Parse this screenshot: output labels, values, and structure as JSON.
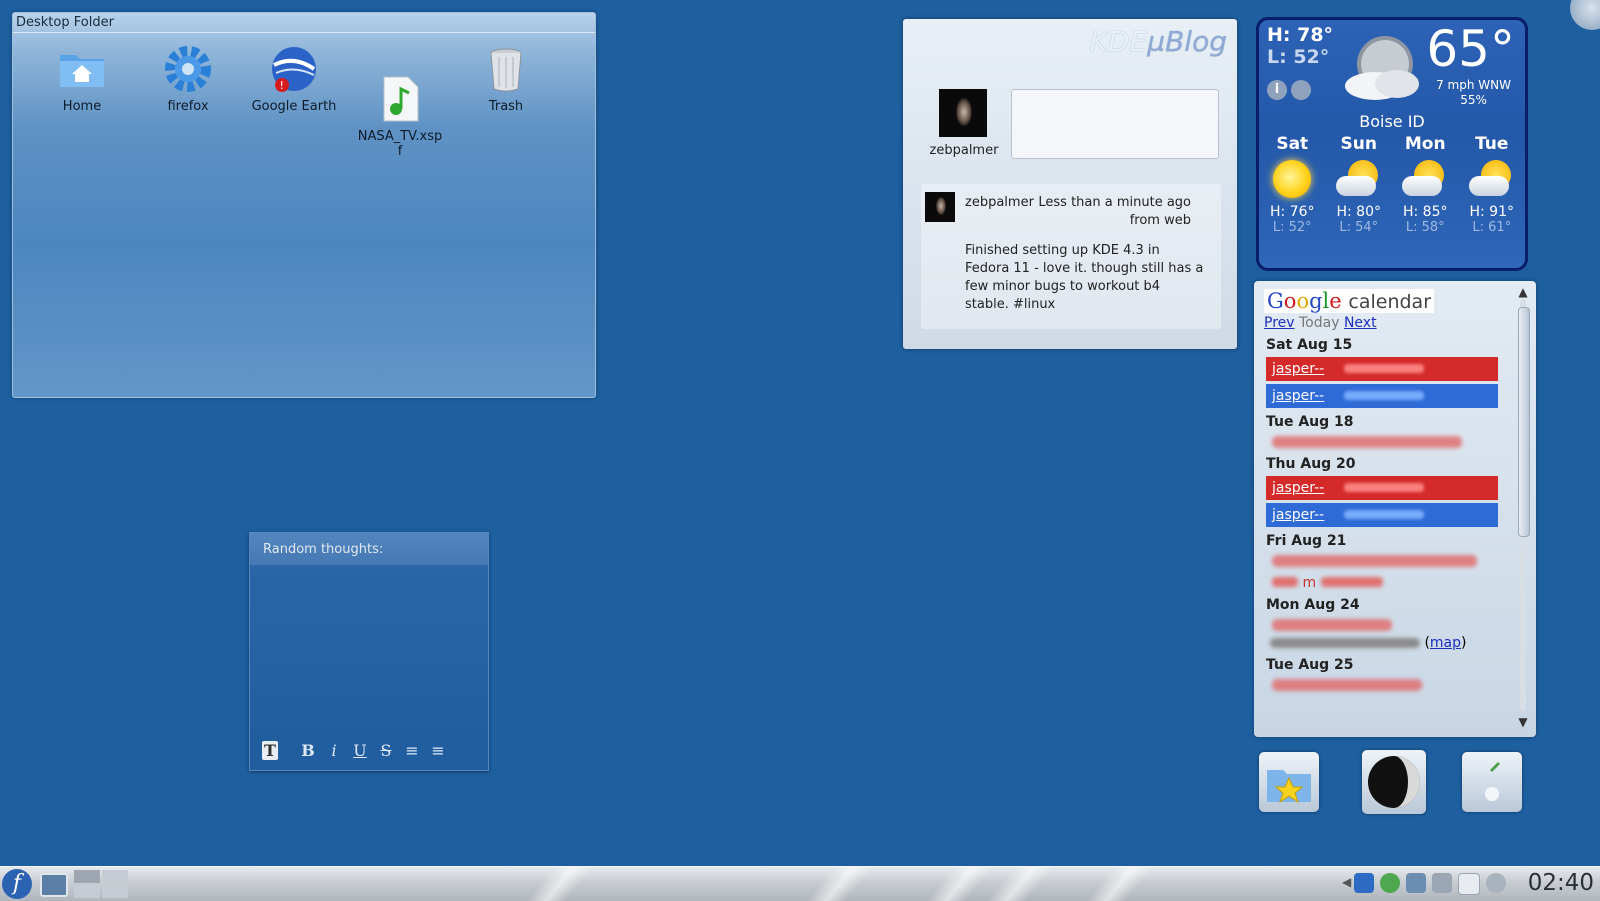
{
  "desktop_folder": {
    "title": "Desktop Folder",
    "items": [
      {
        "label": "Home",
        "icon": "home-folder-icon"
      },
      {
        "label": "firefox",
        "icon": "gear-icon"
      },
      {
        "label": "Google Earth",
        "icon": "globe-icon"
      },
      {
        "label": "NASA_TV.xsp\nf",
        "icon": "audio-file-icon"
      },
      {
        "label": "Trash",
        "icon": "trash-icon"
      }
    ]
  },
  "microblog": {
    "logo_prefix": "KDE",
    "logo_suffix": "µBlog",
    "username": "zebpalmer",
    "post": {
      "user": "zebpalmer",
      "time": "Less than a minute ago",
      "source": "from web",
      "text": "Finished setting up KDE 4.3 in Fedora 11 - love it. though still has a few minor bugs to workout b4 stable. #linux"
    }
  },
  "weather": {
    "high": "H: 78°",
    "low": "L: 52°",
    "current_temp": "65°",
    "wind": "7 mph WNW",
    "humidity": "55%",
    "city": "Boise ID",
    "forecast": [
      {
        "day": "Sat",
        "high": "H: 76°",
        "low": "L: 52°",
        "icon": "sun-icon"
      },
      {
        "day": "Sun",
        "high": "H: 80°",
        "low": "L: 54°",
        "icon": "partly-cloudy-icon"
      },
      {
        "day": "Mon",
        "high": "H: 85°",
        "low": "L: 58°",
        "icon": "partly-cloudy-icon"
      },
      {
        "day": "Tue",
        "high": "H: 91°",
        "low": "L: 61°",
        "icon": "partly-cloudy-icon"
      }
    ]
  },
  "notes": {
    "title": "Random thoughts:",
    "toolbar": [
      "T",
      "B",
      "i",
      "U",
      "S",
      "≡",
      "≡"
    ]
  },
  "calendar": {
    "logo_google": [
      "G",
      "o",
      "o",
      "g",
      "l",
      "e"
    ],
    "logo_calendar": "calendar",
    "nav_prev": "Prev",
    "nav_today": "Today",
    "nav_next": "Next",
    "days": [
      {
        "date": "Sat Aug 15",
        "events": [
          {
            "label": "jasper--",
            "color": "red"
          },
          {
            "label": "jasper--",
            "color": "blue"
          }
        ]
      },
      {
        "date": "Tue Aug 18",
        "events": []
      },
      {
        "date": "Thu Aug 20",
        "events": [
          {
            "label": "jasper--",
            "color": "red"
          },
          {
            "label": "jasper--",
            "color": "blue"
          }
        ]
      },
      {
        "date": "Fri Aug 21",
        "events": []
      },
      {
        "date": "Mon Aug 24",
        "events": []
      },
      {
        "date": "Tue Aug 25",
        "events": []
      }
    ],
    "fri_partial": "m",
    "map_link": "map"
  },
  "taskbar": {
    "clock": "02:40"
  },
  "colors": {
    "desktop": "#1d5f9f",
    "event_red": "#d42a2a",
    "event_blue": "#2f6bd6"
  }
}
